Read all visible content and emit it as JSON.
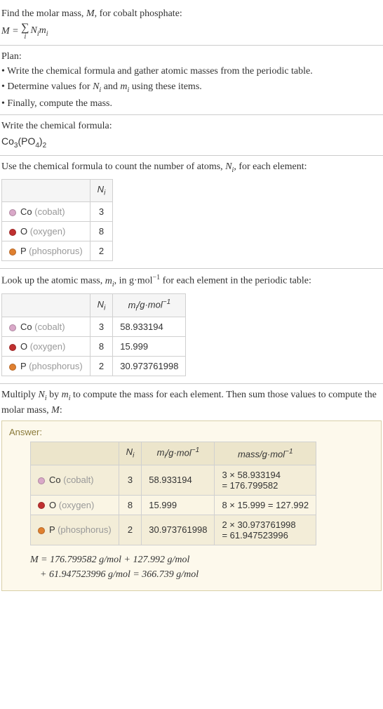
{
  "intro": {
    "line1": "Find the molar mass, M, for cobalt phosphate:",
    "formula_lhs": "M =",
    "formula_rhs": "Nᵢmᵢ",
    "sigma_sub": "i"
  },
  "plan": {
    "heading": "Plan:",
    "b1": "• Write the chemical formula and gather atomic masses from the periodic table.",
    "b2": "• Determine values for Nᵢ and mᵢ using these items.",
    "b3": "• Finally, compute the mass."
  },
  "formula_section": {
    "heading": "Write the chemical formula:",
    "chem": "Co₃(PO₄)₂"
  },
  "count_section": {
    "heading": "Use the chemical formula to count the number of atoms, Nᵢ, for each element:",
    "header_Ni": "Nᵢ",
    "rows": [
      {
        "color": "#d9a8c8",
        "sym": "Co",
        "name": "(cobalt)",
        "n": "3"
      },
      {
        "color": "#c03030",
        "sym": "O",
        "name": "(oxygen)",
        "n": "8"
      },
      {
        "color": "#e08030",
        "sym": "P",
        "name": "(phosphorus)",
        "n": "2"
      }
    ]
  },
  "mass_section": {
    "heading_a": "Look up the atomic mass, mᵢ, in g·mol",
    "heading_b": " for each element in the periodic table:",
    "sup": "−1",
    "header_Ni": "Nᵢ",
    "header_mi": "mᵢ/g·mol⁻¹",
    "rows": [
      {
        "color": "#d9a8c8",
        "sym": "Co",
        "name": "(cobalt)",
        "n": "3",
        "m": "58.933194"
      },
      {
        "color": "#c03030",
        "sym": "O",
        "name": "(oxygen)",
        "n": "8",
        "m": "15.999"
      },
      {
        "color": "#e08030",
        "sym": "P",
        "name": "(phosphorus)",
        "n": "2",
        "m": "30.973761998"
      }
    ]
  },
  "multiply_section": {
    "text": "Multiply Nᵢ by mᵢ to compute the mass for each element. Then sum those values to compute the molar mass, M:"
  },
  "answer": {
    "label": "Answer:",
    "header_Ni": "Nᵢ",
    "header_mi": "mᵢ/g·mol⁻¹",
    "header_mass": "mass/g·mol⁻¹",
    "rows": [
      {
        "color": "#d9a8c8",
        "sym": "Co",
        "name": "(cobalt)",
        "n": "3",
        "m": "58.933194",
        "calc": "3 × 58.933194 = 176.799582"
      },
      {
        "color": "#c03030",
        "sym": "O",
        "name": "(oxygen)",
        "n": "8",
        "m": "15.999",
        "calc": "8 × 15.999 = 127.992"
      },
      {
        "color": "#e08030",
        "sym": "P",
        "name": "(phosphorus)",
        "n": "2",
        "m": "30.973761998",
        "calc": "2 × 30.973761998 = 61.947523996"
      }
    ],
    "final1": "M = 176.799582 g/mol + 127.992 g/mol",
    "final2": "+ 61.947523996 g/mol = 366.739 g/mol"
  }
}
